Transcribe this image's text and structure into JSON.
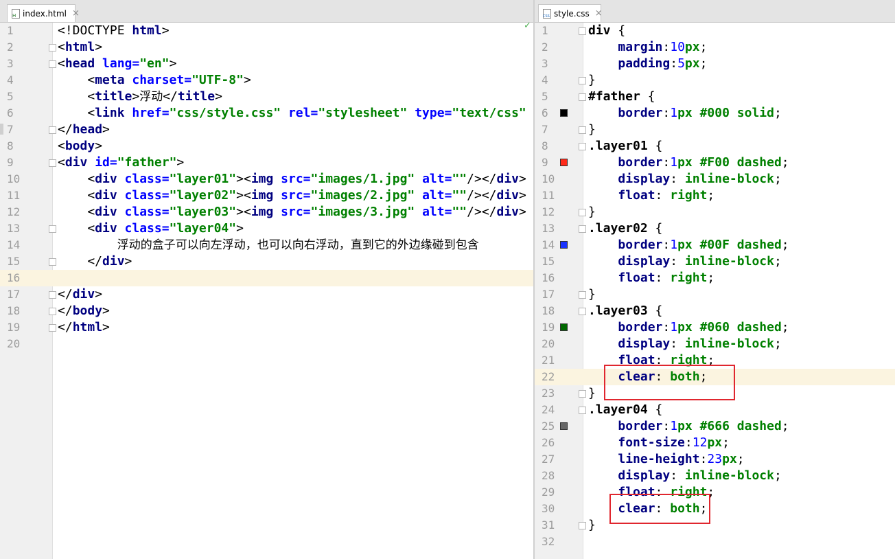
{
  "left_tab": {
    "label": "index.html",
    "close": "×"
  },
  "right_tab": {
    "label": "style.css",
    "close": "×"
  },
  "left_lines": [
    {
      "n": "1",
      "t": [
        [
          "pl",
          "<!DOCTYPE "
        ],
        [
          "tg",
          "html"
        ],
        [
          "pl",
          ">"
        ]
      ]
    },
    {
      "n": "2",
      "t": [
        [
          "pl",
          "<"
        ],
        [
          "tg",
          "html"
        ],
        [
          "pl",
          ">"
        ]
      ]
    },
    {
      "n": "3",
      "t": [
        [
          "pl",
          "<"
        ],
        [
          "tg",
          "head "
        ],
        [
          "at",
          "lang="
        ],
        [
          "av",
          "\"en\""
        ],
        [
          "pl",
          ">"
        ]
      ]
    },
    {
      "n": "4",
      "t": [
        [
          "pl",
          "    <"
        ],
        [
          "tg",
          "meta "
        ],
        [
          "at",
          "charset="
        ],
        [
          "av",
          "\"UTF-8\""
        ],
        [
          "pl",
          ">"
        ]
      ]
    },
    {
      "n": "5",
      "t": [
        [
          "pl",
          "    <"
        ],
        [
          "tg",
          "title"
        ],
        [
          "pl",
          ">"
        ],
        [
          "cn",
          "浮动"
        ],
        [
          "pl",
          "</"
        ],
        [
          "tg",
          "title"
        ],
        [
          "pl",
          ">"
        ]
      ]
    },
    {
      "n": "6",
      "t": [
        [
          "pl",
          "    <"
        ],
        [
          "tg",
          "link "
        ],
        [
          "at",
          "href="
        ],
        [
          "av",
          "\"css/style.css\" "
        ],
        [
          "at",
          "rel="
        ],
        [
          "av",
          "\"stylesheet\" "
        ],
        [
          "at",
          "type="
        ],
        [
          "av",
          "\"text/css\""
        ]
      ]
    },
    {
      "n": "7",
      "t": [
        [
          "pl",
          "</"
        ],
        [
          "tg",
          "head"
        ],
        [
          "pl",
          ">"
        ]
      ]
    },
    {
      "n": "8",
      "t": [
        [
          "pl",
          "<"
        ],
        [
          "tg",
          "body"
        ],
        [
          "pl",
          ">"
        ]
      ]
    },
    {
      "n": "9",
      "t": [
        [
          "pl",
          "<"
        ],
        [
          "tg",
          "div "
        ],
        [
          "at",
          "id="
        ],
        [
          "av",
          "\"father\""
        ],
        [
          "pl",
          ">"
        ]
      ]
    },
    {
      "n": "10",
      "t": [
        [
          "pl",
          "    <"
        ],
        [
          "tg",
          "div "
        ],
        [
          "at",
          "class="
        ],
        [
          "av",
          "\"layer01\""
        ],
        [
          "pl",
          ">"
        ],
        [
          "pl",
          "<"
        ],
        [
          "tg",
          "img "
        ],
        [
          "at",
          "src="
        ],
        [
          "av",
          "\"images/1.jpg\" "
        ],
        [
          "at",
          "alt="
        ],
        [
          "av",
          "\"\""
        ],
        [
          "pl",
          "/></"
        ],
        [
          "tg",
          "div"
        ],
        [
          "pl",
          ">"
        ]
      ]
    },
    {
      "n": "11",
      "t": [
        [
          "pl",
          "    <"
        ],
        [
          "tg",
          "div "
        ],
        [
          "at",
          "class="
        ],
        [
          "av",
          "\"layer02\""
        ],
        [
          "pl",
          ">"
        ],
        [
          "pl",
          "<"
        ],
        [
          "tg",
          "img "
        ],
        [
          "at",
          "src="
        ],
        [
          "av",
          "\"images/2.jpg\" "
        ],
        [
          "at",
          "alt="
        ],
        [
          "av",
          "\"\""
        ],
        [
          "pl",
          "/></"
        ],
        [
          "tg",
          "div"
        ],
        [
          "pl",
          ">"
        ]
      ]
    },
    {
      "n": "12",
      "t": [
        [
          "pl",
          "    <"
        ],
        [
          "tg",
          "div "
        ],
        [
          "at",
          "class="
        ],
        [
          "av",
          "\"layer03\""
        ],
        [
          "pl",
          ">"
        ],
        [
          "pl",
          "<"
        ],
        [
          "tg",
          "img "
        ],
        [
          "at",
          "src="
        ],
        [
          "av",
          "\"images/3.jpg\" "
        ],
        [
          "at",
          "alt="
        ],
        [
          "av",
          "\"\""
        ],
        [
          "pl",
          "/></"
        ],
        [
          "tg",
          "div"
        ],
        [
          "pl",
          ">"
        ]
      ]
    },
    {
      "n": "13",
      "t": [
        [
          "pl",
          "    <"
        ],
        [
          "tg",
          "div "
        ],
        [
          "at",
          "class="
        ],
        [
          "av",
          "\"layer04\""
        ],
        [
          "pl",
          ">"
        ]
      ]
    },
    {
      "n": "14",
      "t": [
        [
          "pl",
          "        "
        ],
        [
          "cn",
          "浮动的盒子可以向左浮动，也可以向右浮动，直到它的外边缘碰到包含"
        ]
      ]
    },
    {
      "n": "15",
      "t": [
        [
          "pl",
          "    </"
        ],
        [
          "tg",
          "div"
        ],
        [
          "pl",
          ">"
        ]
      ]
    },
    {
      "n": "16",
      "t": [],
      "hl": true
    },
    {
      "n": "17",
      "t": [
        [
          "pl",
          "</"
        ],
        [
          "tg",
          "div"
        ],
        [
          "pl",
          ">"
        ]
      ]
    },
    {
      "n": "18",
      "t": [
        [
          "pl",
          "</"
        ],
        [
          "tg",
          "body"
        ],
        [
          "pl",
          ">"
        ]
      ]
    },
    {
      "n": "19",
      "t": [
        [
          "pl",
          "</"
        ],
        [
          "tg",
          "html"
        ],
        [
          "pl",
          ">"
        ]
      ]
    },
    {
      "n": "20",
      "t": []
    }
  ],
  "right_lines": [
    {
      "n": "1",
      "t": [
        [
          "sel",
          "div "
        ],
        [
          "pl",
          "{"
        ]
      ]
    },
    {
      "n": "2",
      "t": [
        [
          "pl",
          "    "
        ],
        [
          "prop",
          "margin"
        ],
        [
          "pl",
          ":"
        ],
        [
          "num",
          "10"
        ],
        [
          "val",
          "px"
        ],
        [
          "pl",
          ";"
        ]
      ]
    },
    {
      "n": "3",
      "t": [
        [
          "pl",
          "    "
        ],
        [
          "prop",
          "padding"
        ],
        [
          "pl",
          ":"
        ],
        [
          "num",
          "5"
        ],
        [
          "val",
          "px"
        ],
        [
          "pl",
          ";"
        ]
      ]
    },
    {
      "n": "4",
      "t": [
        [
          "pl",
          "}"
        ]
      ]
    },
    {
      "n": "5",
      "t": [
        [
          "sel",
          "#father "
        ],
        [
          "pl",
          "{"
        ]
      ]
    },
    {
      "n": "6",
      "t": [
        [
          "pl",
          "    "
        ],
        [
          "prop",
          "border"
        ],
        [
          "pl",
          ":"
        ],
        [
          "num",
          "1"
        ],
        [
          "val",
          "px #000 solid"
        ],
        [
          "pl",
          ";"
        ]
      ],
      "swatch": "#000000"
    },
    {
      "n": "7",
      "t": [
        [
          "pl",
          "}"
        ]
      ]
    },
    {
      "n": "8",
      "t": [
        [
          "sel",
          ".layer01 "
        ],
        [
          "pl",
          "{"
        ]
      ]
    },
    {
      "n": "9",
      "t": [
        [
          "pl",
          "    "
        ],
        [
          "prop",
          "border"
        ],
        [
          "pl",
          ":"
        ],
        [
          "num",
          "1"
        ],
        [
          "val",
          "px #F00 dashed"
        ],
        [
          "pl",
          ";"
        ]
      ],
      "swatch": "#ff2a1a"
    },
    {
      "n": "10",
      "t": [
        [
          "pl",
          "    "
        ],
        [
          "prop",
          "display"
        ],
        [
          "pl",
          ": "
        ],
        [
          "val",
          "inline-block"
        ],
        [
          "pl",
          ";"
        ]
      ]
    },
    {
      "n": "11",
      "t": [
        [
          "pl",
          "    "
        ],
        [
          "prop",
          "float"
        ],
        [
          "pl",
          ": "
        ],
        [
          "val",
          "right"
        ],
        [
          "pl",
          ";"
        ]
      ]
    },
    {
      "n": "12",
      "t": [
        [
          "pl",
          "}"
        ]
      ]
    },
    {
      "n": "13",
      "t": [
        [
          "sel",
          ".layer02 "
        ],
        [
          "pl",
          "{"
        ]
      ]
    },
    {
      "n": "14",
      "t": [
        [
          "pl",
          "    "
        ],
        [
          "prop",
          "border"
        ],
        [
          "pl",
          ":"
        ],
        [
          "num",
          "1"
        ],
        [
          "val",
          "px #00F dashed"
        ],
        [
          "pl",
          ";"
        ]
      ],
      "swatch": "#1a33ff"
    },
    {
      "n": "15",
      "t": [
        [
          "pl",
          "    "
        ],
        [
          "prop",
          "display"
        ],
        [
          "pl",
          ": "
        ],
        [
          "val",
          "inline-block"
        ],
        [
          "pl",
          ";"
        ]
      ]
    },
    {
      "n": "16",
      "t": [
        [
          "pl",
          "    "
        ],
        [
          "prop",
          "float"
        ],
        [
          "pl",
          ": "
        ],
        [
          "val",
          "right"
        ],
        [
          "pl",
          ";"
        ]
      ]
    },
    {
      "n": "17",
      "t": [
        [
          "pl",
          "}"
        ]
      ]
    },
    {
      "n": "18",
      "t": [
        [
          "sel",
          ".layer03 "
        ],
        [
          "pl",
          "{"
        ]
      ]
    },
    {
      "n": "19",
      "t": [
        [
          "pl",
          "    "
        ],
        [
          "prop",
          "border"
        ],
        [
          "pl",
          ":"
        ],
        [
          "num",
          "1"
        ],
        [
          "val",
          "px #060 dashed"
        ],
        [
          "pl",
          ";"
        ]
      ],
      "swatch": "#006600"
    },
    {
      "n": "20",
      "t": [
        [
          "pl",
          "    "
        ],
        [
          "prop",
          "display"
        ],
        [
          "pl",
          ": "
        ],
        [
          "val",
          "inline-block"
        ],
        [
          "pl",
          ";"
        ]
      ]
    },
    {
      "n": "21",
      "t": [
        [
          "pl",
          "    "
        ],
        [
          "prop",
          "float"
        ],
        [
          "pl",
          ": "
        ],
        [
          "val",
          "right"
        ],
        [
          "pl",
          ";"
        ]
      ]
    },
    {
      "n": "22",
      "t": [
        [
          "pl",
          "    "
        ],
        [
          "prop",
          "clear"
        ],
        [
          "pl",
          ": "
        ],
        [
          "val",
          "both"
        ],
        [
          "pl",
          ";"
        ]
      ],
      "hl": true
    },
    {
      "n": "23",
      "t": [
        [
          "pl",
          "}"
        ]
      ]
    },
    {
      "n": "24",
      "t": [
        [
          "sel",
          ".layer04 "
        ],
        [
          "pl",
          "{"
        ]
      ]
    },
    {
      "n": "25",
      "t": [
        [
          "pl",
          "    "
        ],
        [
          "prop",
          "border"
        ],
        [
          "pl",
          ":"
        ],
        [
          "num",
          "1"
        ],
        [
          "val",
          "px #666 dashed"
        ],
        [
          "pl",
          ";"
        ]
      ],
      "swatch": "#666666"
    },
    {
      "n": "26",
      "t": [
        [
          "pl",
          "    "
        ],
        [
          "prop",
          "font-size"
        ],
        [
          "pl",
          ":"
        ],
        [
          "num",
          "12"
        ],
        [
          "val",
          "px"
        ],
        [
          "pl",
          ";"
        ]
      ]
    },
    {
      "n": "27",
      "t": [
        [
          "pl",
          "    "
        ],
        [
          "prop",
          "line-height"
        ],
        [
          "pl",
          ":"
        ],
        [
          "num",
          "23"
        ],
        [
          "val",
          "px"
        ],
        [
          "pl",
          ";"
        ]
      ]
    },
    {
      "n": "28",
      "t": [
        [
          "pl",
          "    "
        ],
        [
          "prop",
          "display"
        ],
        [
          "pl",
          ": "
        ],
        [
          "val",
          "inline-block"
        ],
        [
          "pl",
          ";"
        ]
      ]
    },
    {
      "n": "29",
      "t": [
        [
          "pl",
          "    "
        ],
        [
          "prop",
          "float"
        ],
        [
          "pl",
          ": "
        ],
        [
          "val",
          "right"
        ],
        [
          "pl",
          ";"
        ]
      ]
    },
    {
      "n": "30",
      "t": [
        [
          "pl",
          "    "
        ],
        [
          "prop",
          "clear"
        ],
        [
          "pl",
          ": "
        ],
        [
          "val",
          "both"
        ],
        [
          "pl",
          ";"
        ]
      ]
    },
    {
      "n": "31",
      "t": [
        [
          "pl",
          "}"
        ]
      ]
    },
    {
      "n": "32",
      "t": []
    }
  ],
  "status": {
    "check": "✓"
  }
}
